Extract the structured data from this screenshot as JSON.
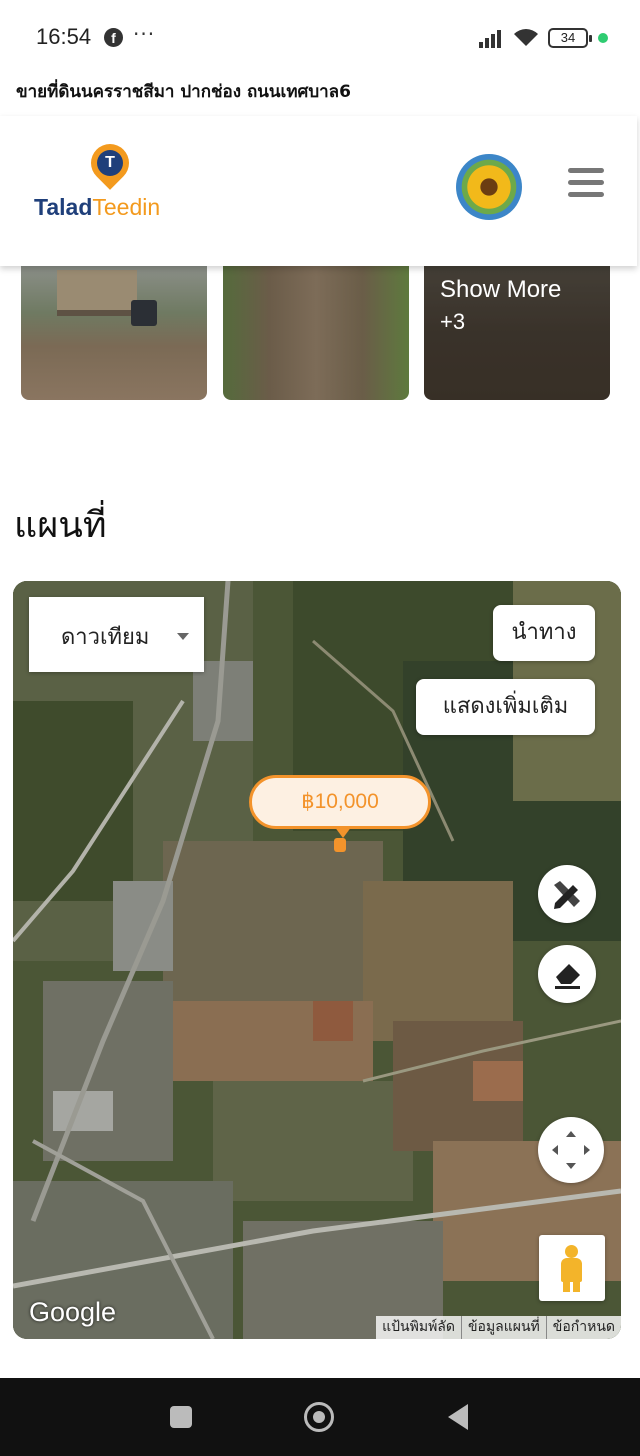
{
  "status_bar": {
    "time": "16:54",
    "more": "···",
    "battery": "34",
    "icons": [
      "facebook-icon",
      "signal-icon",
      "wifi-icon",
      "battery-icon"
    ]
  },
  "page": {
    "title": "ขายที่ดินนครราชสีมา ปากช่อง ถนนเทศบาล6"
  },
  "header": {
    "logo_part1": "Talad",
    "logo_part2": "Teedin",
    "logo_pin": "T",
    "brand_colors": {
      "navy": "#1f3f7a",
      "orange": "#f39a1e"
    }
  },
  "gallery": {
    "show_more_label": "Show More",
    "show_more_count": "+3"
  },
  "map_section": {
    "heading": "แผนที่",
    "map_type": "ดาวเทียม",
    "directions_label": "นำทาง",
    "show_more_label": "แสดงเพิ่มเติม",
    "price": "฿10,000",
    "google_logo": "Google",
    "attribution": [
      "แป้นพิมพ์ลัด",
      "ข้อมูลแผนที่",
      "ข้อกำหนด"
    ],
    "accent_color": "#f3932b"
  }
}
